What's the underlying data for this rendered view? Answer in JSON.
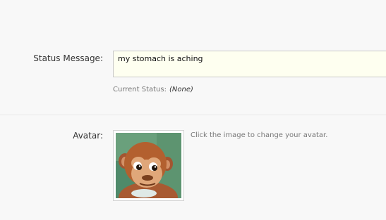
{
  "status": {
    "label": "Status Message:",
    "value": "my stomach is aching",
    "current_label": "Current Status:",
    "current_value": "(None)"
  },
  "avatar": {
    "label": "Avatar:",
    "hint": "Click the image to change your avatar.",
    "image_subject": "monkey puppet"
  }
}
